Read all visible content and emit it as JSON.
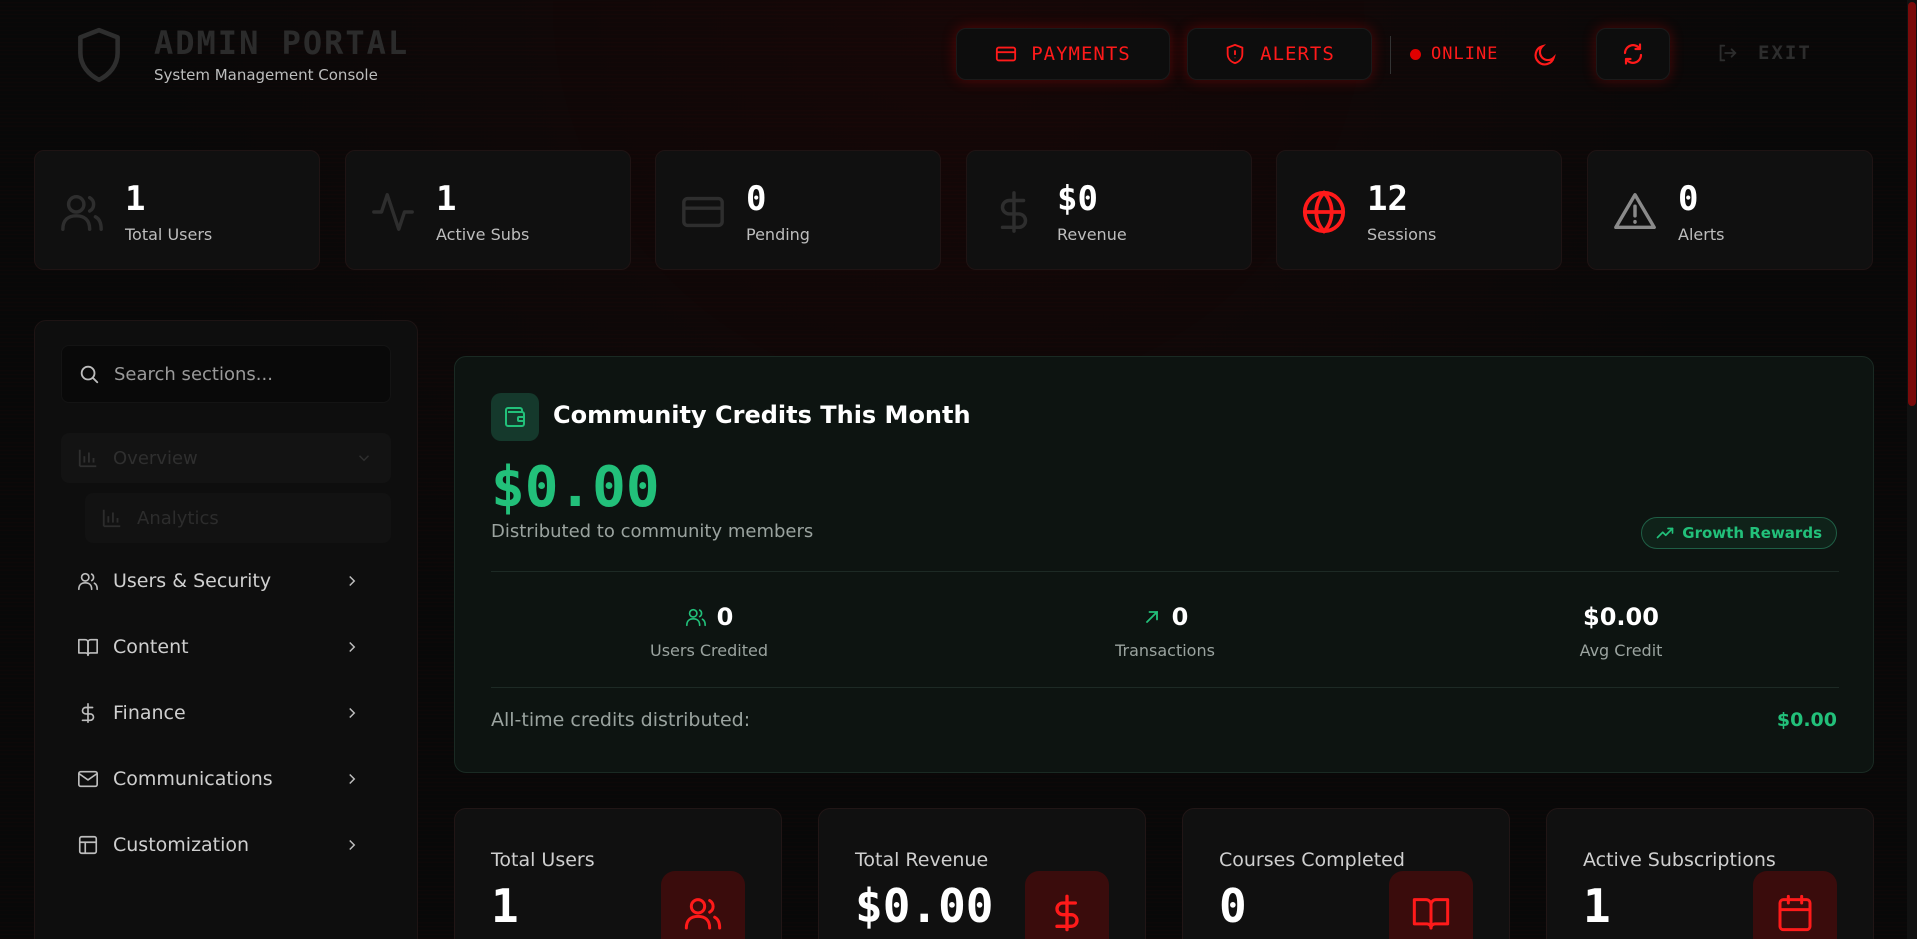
{
  "header": {
    "title": "ADMIN PORTAL",
    "subtitle": "System Management Console",
    "payments_label": "PAYMENTS",
    "alerts_label": "ALERTS",
    "status_label": "ONLINE",
    "exit_label": "EXIT"
  },
  "stats": [
    {
      "value": "1",
      "label": "Total Users",
      "icon": "users-icon"
    },
    {
      "value": "1",
      "label": "Active Subs",
      "icon": "activity-icon"
    },
    {
      "value": "0",
      "label": "Pending",
      "icon": "credit-card-icon"
    },
    {
      "value": "$0",
      "label": "Revenue",
      "icon": "dollar-icon"
    },
    {
      "value": "12",
      "label": "Sessions",
      "icon": "globe-icon"
    },
    {
      "value": "0",
      "label": "Alerts",
      "icon": "warning-icon"
    }
  ],
  "sidebar": {
    "search_placeholder": "Search sections...",
    "overview_label": "Overview",
    "analytics_label": "Analytics",
    "items": [
      {
        "label": "Users & Security",
        "icon": "users-icon"
      },
      {
        "label": "Content",
        "icon": "book-icon"
      },
      {
        "label": "Finance",
        "icon": "dollar-icon"
      },
      {
        "label": "Communications",
        "icon": "mail-icon"
      },
      {
        "label": "Customization",
        "icon": "layout-icon"
      }
    ]
  },
  "credits": {
    "title": "Community Credits This Month",
    "amount": "$0.00",
    "subtitle": "Distributed to community members",
    "badge": "Growth Rewards",
    "stats": [
      {
        "value": "0",
        "label": "Users Credited"
      },
      {
        "value": "0",
        "label": "Transactions"
      },
      {
        "value": "$0.00",
        "label": "Avg Credit"
      }
    ],
    "alltime_label": "All-time credits distributed:",
    "alltime_value": "$0.00"
  },
  "cards": [
    {
      "label": "Total Users",
      "value": "1",
      "icon": "users-icon"
    },
    {
      "label": "Total Revenue",
      "value": "$0.00",
      "icon": "dollar-icon"
    },
    {
      "label": "Courses Completed",
      "value": "0",
      "icon": "book-icon"
    },
    {
      "label": "Active Subscriptions",
      "value": "1",
      "icon": "calendar-icon"
    }
  ],
  "colors": {
    "accent_red": "#ff1a1a",
    "accent_green": "#22c07a",
    "background": "#080808"
  }
}
